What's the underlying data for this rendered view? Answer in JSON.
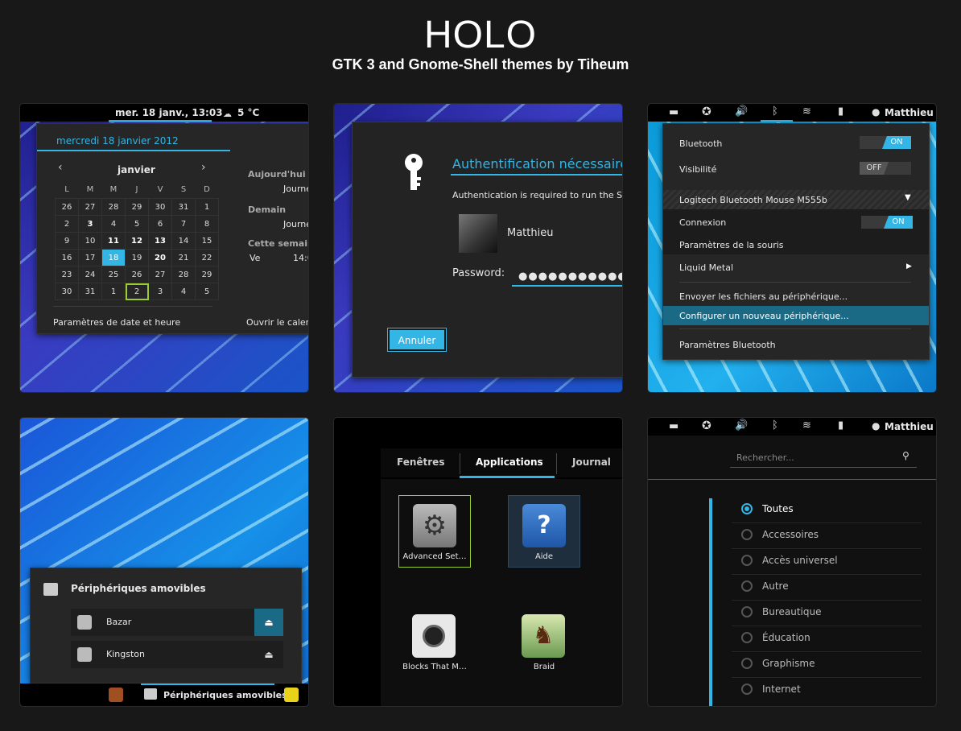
{
  "header": {
    "title": "HOLO",
    "subtitle": "GTK 3 and Gnome-Shell themes by Tiheum"
  },
  "calendar": {
    "clock": "mer. 18 janv., 13:03",
    "weather": "5 °C",
    "date_heading": "mercredi 18 janvier 2012",
    "month": "janvier",
    "weekdays": [
      "L",
      "M",
      "M",
      "J",
      "V",
      "S",
      "D"
    ],
    "days": [
      [
        "26",
        "27",
        "28",
        "29",
        "30",
        "31",
        "1"
      ],
      [
        "2",
        "3",
        "4",
        "5",
        "6",
        "7",
        "8"
      ],
      [
        "9",
        "10",
        "11",
        "12",
        "13",
        "14",
        "15"
      ],
      [
        "16",
        "17",
        "18",
        "19",
        "20",
        "21",
        "22"
      ],
      [
        "23",
        "24",
        "25",
        "26",
        "27",
        "28",
        "29"
      ],
      [
        "30",
        "31",
        "1",
        "2",
        "3",
        "4",
        "5"
      ]
    ],
    "events": {
      "today_label": "Aujourd'hui",
      "today_value": "Journé",
      "tomorrow_label": "Demain",
      "tomorrow_value": "Journé",
      "week_label": "Cette semaine",
      "week_day": "Ve",
      "week_time": "14:0"
    },
    "settings_link": "Paramètres de date et heure",
    "open_calendar": "Ouvrir le calen"
  },
  "auth": {
    "title": "Authentification nécessaire",
    "message": "Authentication is required to run the S",
    "user": "Matthieu",
    "password_label": "Password:",
    "password_value": "●●●●●●●●●●●",
    "cancel": "Annuler"
  },
  "bluetooth": {
    "user": "Matthieu",
    "bluetooth_label": "Bluetooth",
    "bluetooth_state": "ON",
    "visibility_label": "Visibilité",
    "visibility_state": "OFF",
    "device": "Logitech Bluetooth Mouse M555b",
    "connection_label": "Connexion",
    "connection_state": "ON",
    "mouse_settings": "Paramètres de la souris",
    "device2": "Liquid Metal",
    "send_files": "Envoyer les fichiers au périphérique...",
    "configure": "Configurer un nouveau périphérique...",
    "settings": "Paramètres Bluetooth"
  },
  "removable": {
    "title": "Périphériques amovibles",
    "items": [
      "Bazar",
      "Kingston"
    ],
    "taskbar_label": "Périphériques amovibles"
  },
  "overview": {
    "tabs": [
      "Fenêtres",
      "Applications",
      "Journal"
    ],
    "apps": [
      "Advanced Set…",
      "Aide",
      "Blocks That M…",
      "Braid"
    ]
  },
  "categories": {
    "user": "Matthieu",
    "search_placeholder": "Rechercher...",
    "items": [
      "Toutes",
      "Accessoires",
      "Accès universel",
      "Autre",
      "Bureautique",
      "Éducation",
      "Graphisme",
      "Internet"
    ]
  },
  "colors": {
    "accent": "#33b5e5",
    "background": "#181818"
  }
}
